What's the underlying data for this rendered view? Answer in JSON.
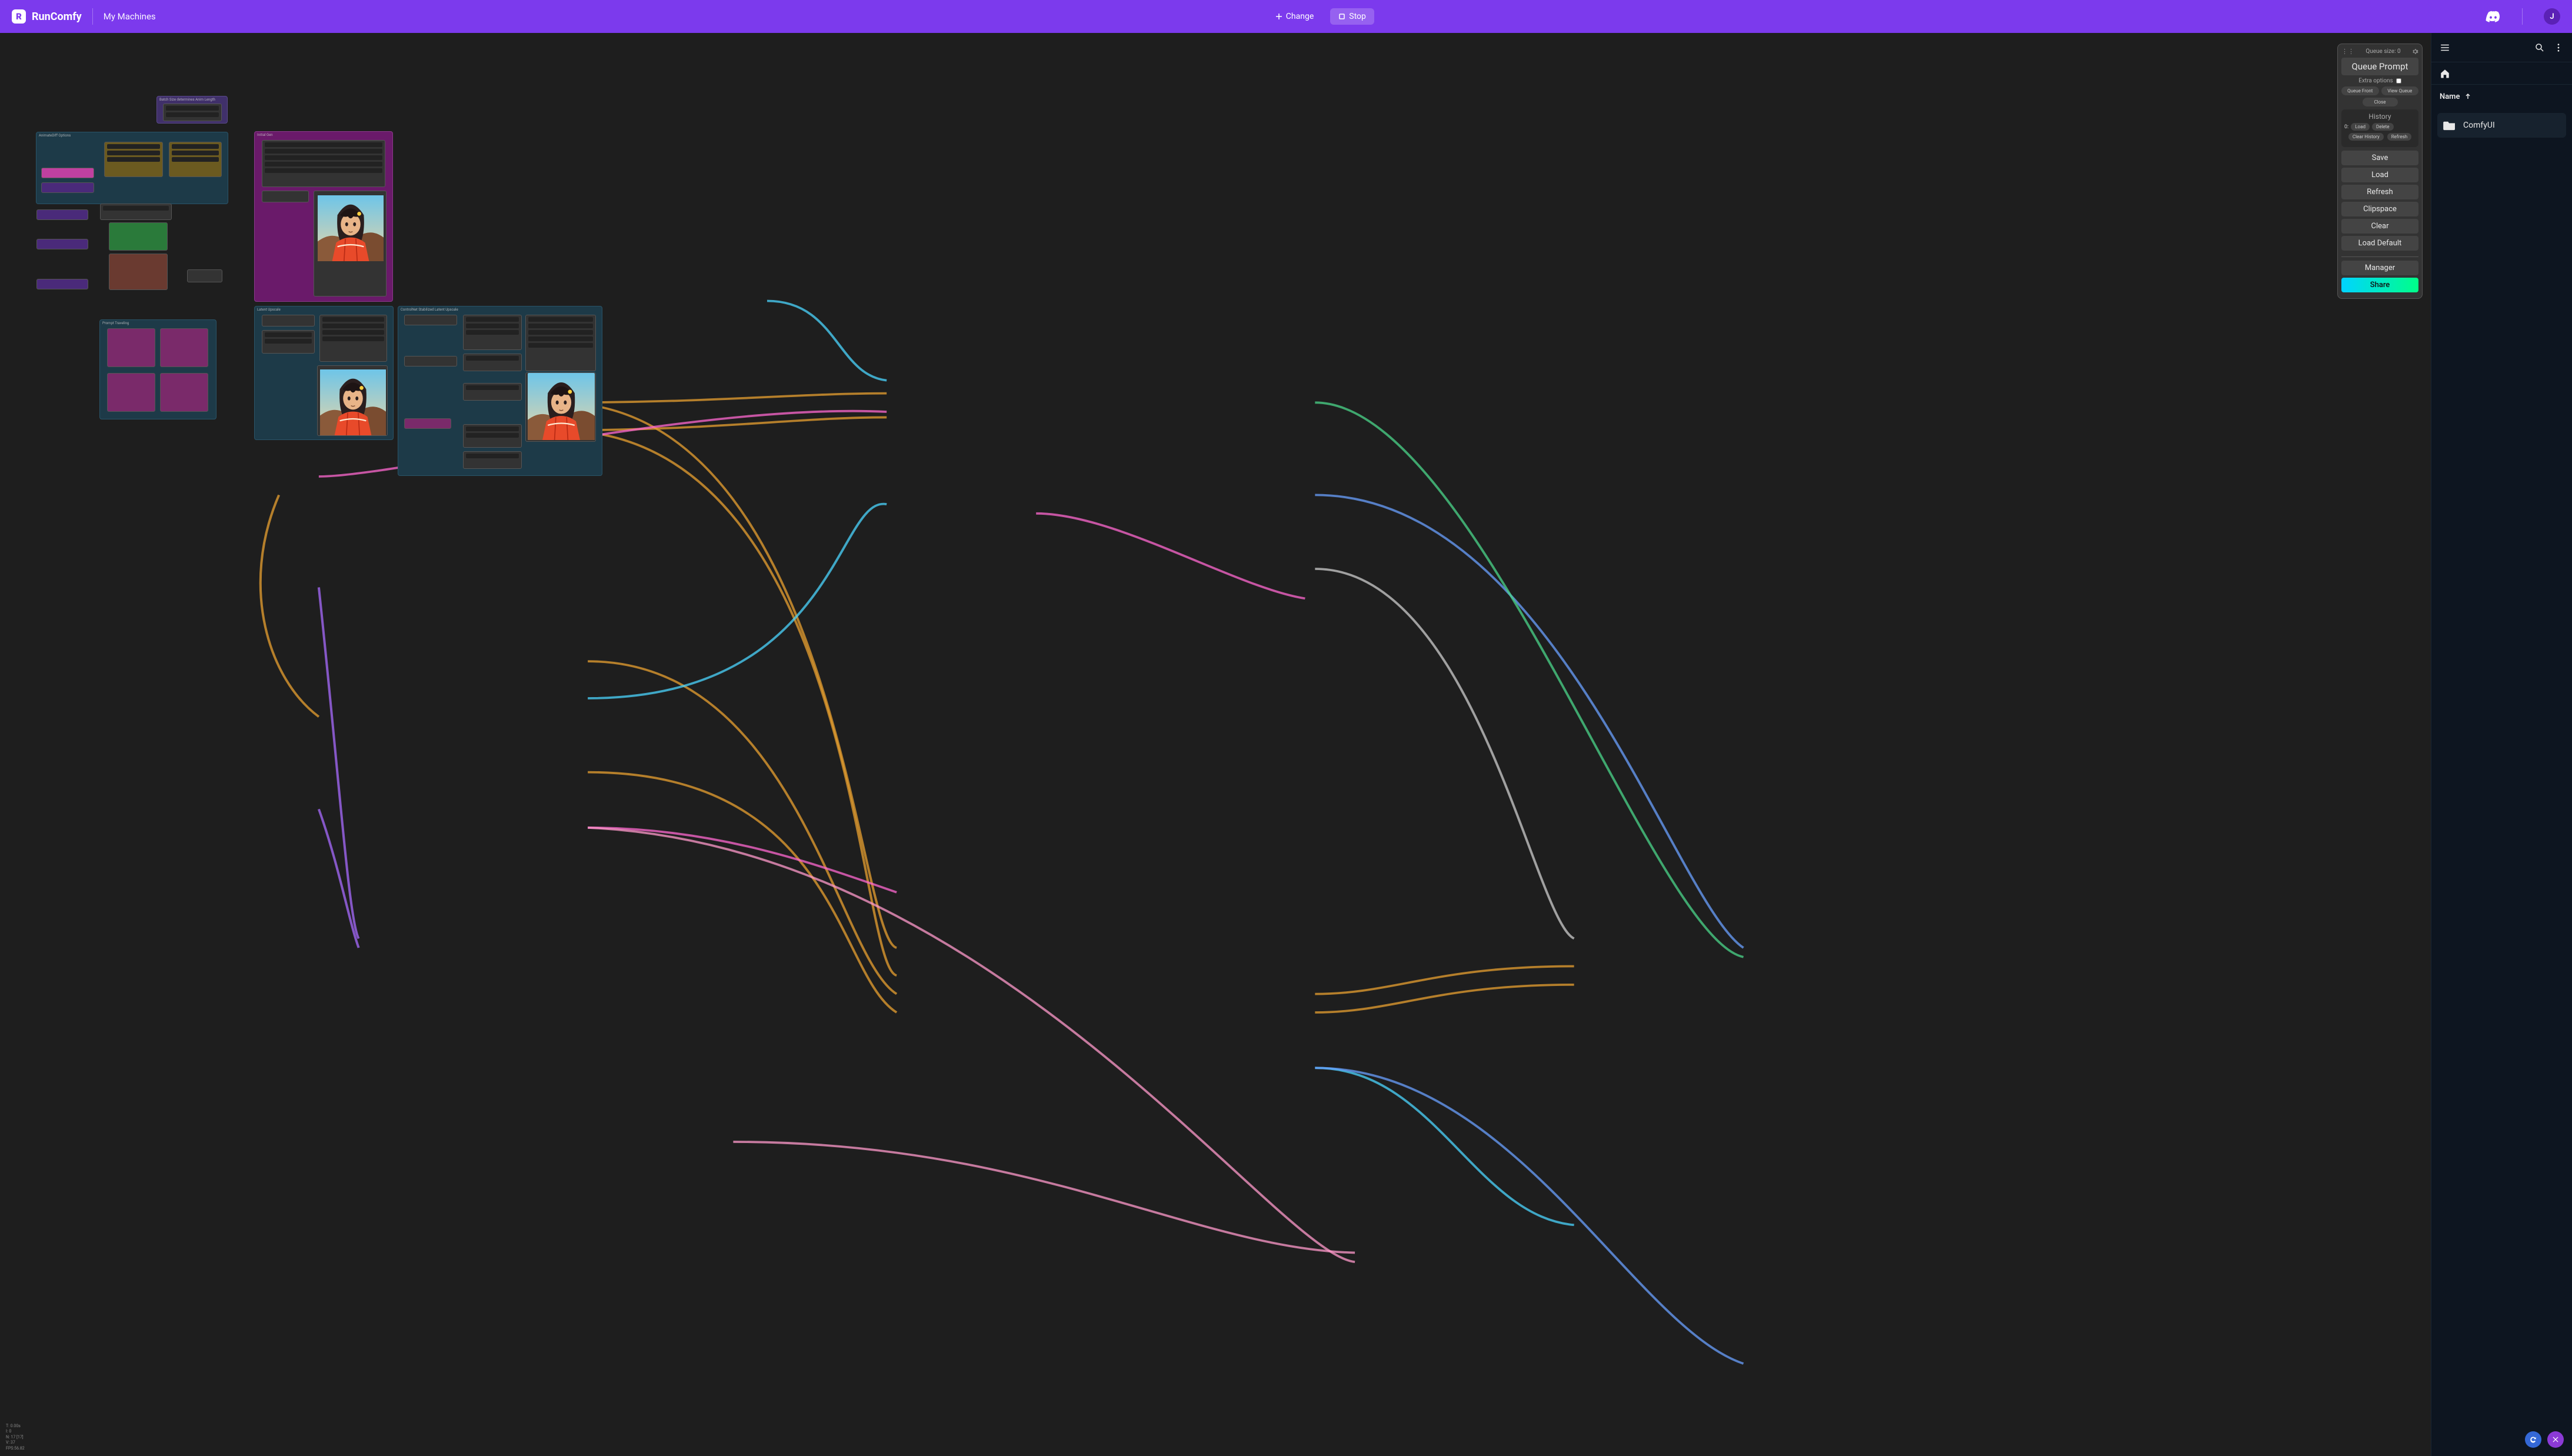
{
  "topbar": {
    "brand": "RunComfy",
    "nav_my_machines": "My Machines",
    "change_label": "Change",
    "stop_label": "Stop",
    "avatar_letter": "J"
  },
  "canvas": {
    "groups": {
      "batch": "Batch Size determines Anim Length",
      "opts": "AnimateDiff Options",
      "initgen": "Initial Gen",
      "prompt": "Prompt Traveling",
      "upscale": "Latent Upscale",
      "ctrl": "ControlNet Stabilized Latent Upscale"
    },
    "stats": {
      "t": "T: 0.00s",
      "i": "I: 0",
      "n": "N: 17 [17]",
      "v": "V: 37",
      "fps": "FPS:56.82"
    }
  },
  "panel": {
    "queue_label": "Queue size: 0",
    "queue_prompt": "Queue Prompt",
    "extra_options": "Extra options",
    "queue_front": "Queue Front",
    "view_queue": "View Queue",
    "close": "Close",
    "history_title": "History",
    "history_index": "0:",
    "history_load": "Load",
    "history_delete": "Delete",
    "clear_history": "Clear History",
    "refresh_hist": "Refresh",
    "save": "Save",
    "load": "Load",
    "refresh": "Refresh",
    "clipspace": "Clipspace",
    "clear": "Clear",
    "load_default": "Load Default",
    "manager": "Manager",
    "share": "Share"
  },
  "right": {
    "name_header": "Name",
    "folder": "ComfyUI"
  }
}
